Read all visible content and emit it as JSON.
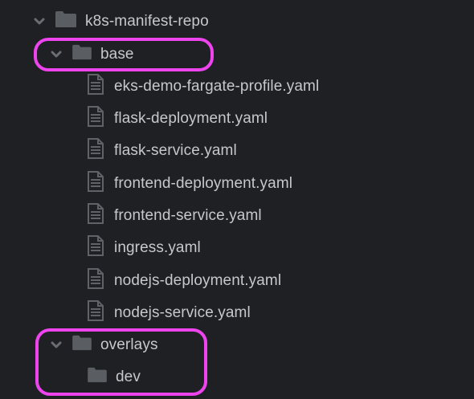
{
  "tree": {
    "root": {
      "label": "k8s-manifest-repo",
      "icon": "folder-icon",
      "expanded": true
    },
    "base": {
      "label": "base",
      "icon": "folder-icon",
      "expanded": true,
      "files": [
        "eks-demo-fargate-profile.yaml",
        "flask-deployment.yaml",
        "flask-service.yaml",
        "frontend-deployment.yaml",
        "frontend-service.yaml",
        "ingress.yaml",
        "nodejs-deployment.yaml",
        "nodejs-service.yaml"
      ]
    },
    "overlays": {
      "label": "overlays",
      "icon": "folder-icon",
      "expanded": true,
      "children": [
        {
          "label": "dev",
          "icon": "folder-icon"
        }
      ]
    }
  },
  "colors": {
    "background": "#1e2023",
    "text": "#c6c8cb",
    "icon": "#5a5e63",
    "highlight": "#ee44ee"
  }
}
